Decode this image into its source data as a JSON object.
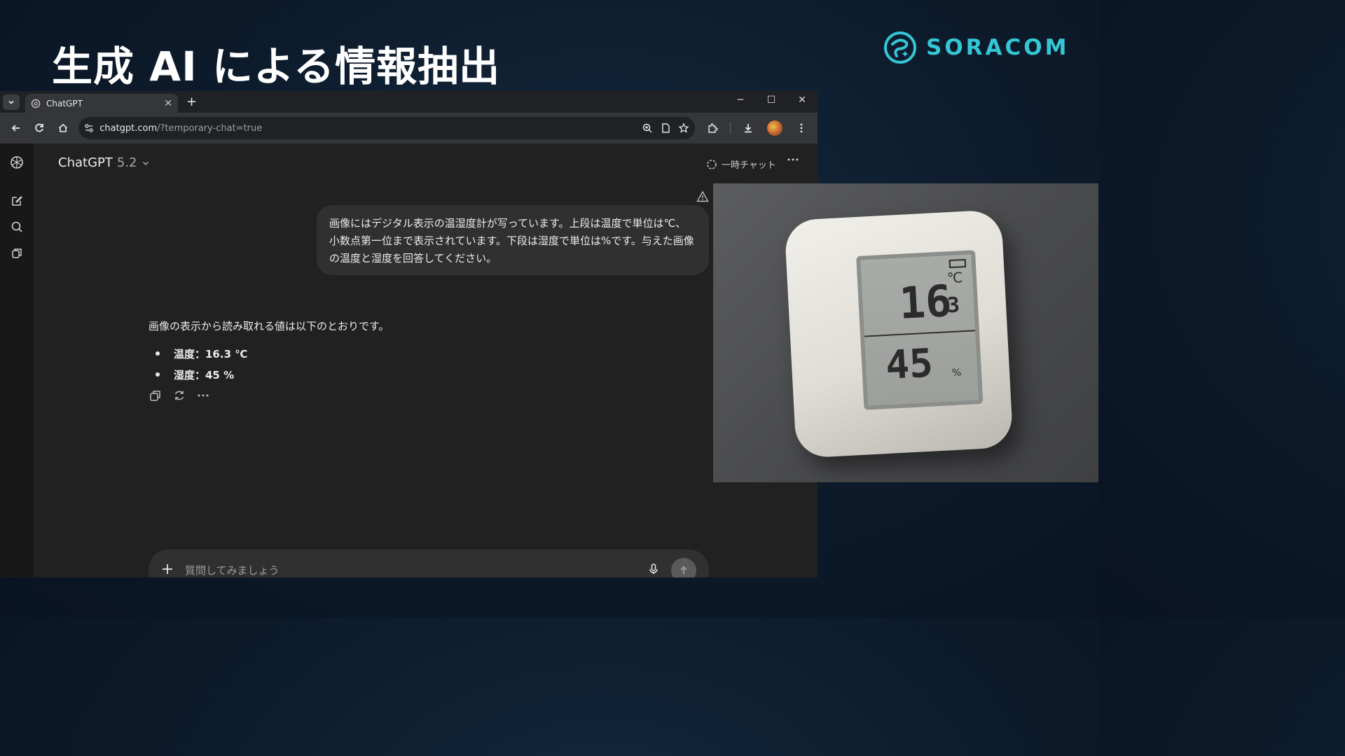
{
  "slide": {
    "title": "生成 AI による情報抽出",
    "logo_text": "SORACOM",
    "accent": "#34c6d4"
  },
  "browser": {
    "tab_title": "ChatGPT",
    "url_host": "chatgpt.com",
    "url_path": "/?temporary-chat=true"
  },
  "chat": {
    "model_name": "ChatGPT",
    "model_version": "5.2",
    "temp_chat_label": "一時チャット",
    "user_message": "画像にはデジタル表示の温湿度計が写っています。上段は温度で単位は℃、小数点第一位まで表示されています。下段は湿度で単位は%です。与えた画像の温度と湿度を回答してください。",
    "assistant_intro": "画像の表示から読み取れる値は以下のとおりです。",
    "assistant_items": [
      "温度：16.3 ℃",
      "湿度：45 %"
    ],
    "composer_placeholder": "質問してみましょう"
  },
  "photo": {
    "temp_int": "16",
    "temp_dec": "3",
    "temp_unit": "℃",
    "humidity": "45",
    "humidity_unit": "%"
  }
}
